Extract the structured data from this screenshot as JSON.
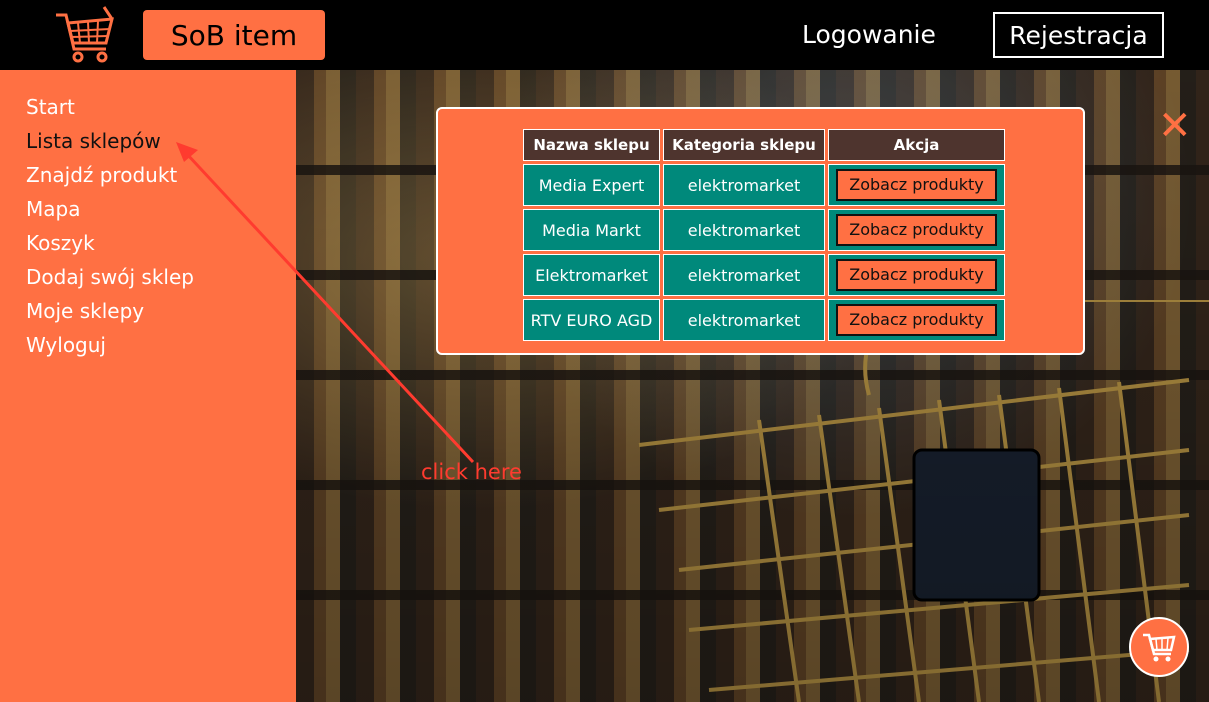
{
  "header": {
    "brand": "SoB item",
    "login": "Logowanie",
    "register": "Rejestracja",
    "icon": "shopping-cart-icon"
  },
  "sidebar": {
    "items": [
      {
        "label": "Start"
      },
      {
        "label": "Lista sklepów"
      },
      {
        "label": "Znajdź produkt"
      },
      {
        "label": "Mapa"
      },
      {
        "label": "Koszyk"
      },
      {
        "label": "Dodaj swój sklep"
      },
      {
        "label": "Moje sklepy"
      },
      {
        "label": "Wyloguj"
      }
    ]
  },
  "modal": {
    "close_icon": "close-icon",
    "columns": [
      "Nazwa sklepu",
      "Kategoria sklepu",
      "Akcja"
    ],
    "rows": [
      {
        "name": "Media Expert",
        "category": "elektromarket",
        "action": "Zobacz produkty"
      },
      {
        "name": "Media Markt",
        "category": "elektromarket",
        "action": "Zobacz produkty"
      },
      {
        "name": "Elektromarket",
        "category": "elektromarket",
        "action": "Zobacz produkty"
      },
      {
        "name": "RTV EURO AGD",
        "category": "elektromarket",
        "action": "Zobacz produkty"
      }
    ]
  },
  "annotation": {
    "text": "click here"
  },
  "colors": {
    "accent": "#ff7043",
    "header_bg": "#000000",
    "table_header": "#4e342e",
    "table_cell": "#00897b",
    "annotation": "#ff3b2f"
  }
}
